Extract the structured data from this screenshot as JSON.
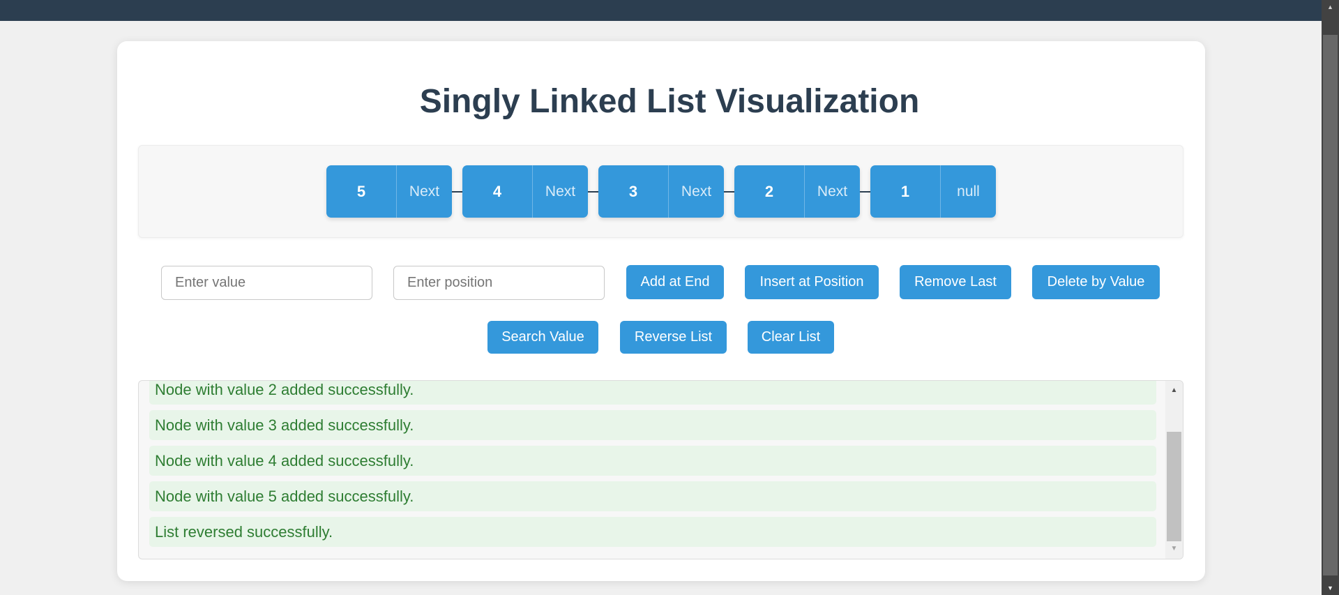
{
  "page": {
    "title": "Singly Linked List Visualization"
  },
  "linked_list": {
    "nodes": [
      {
        "value": "5",
        "pointer": "Next"
      },
      {
        "value": "4",
        "pointer": "Next"
      },
      {
        "value": "3",
        "pointer": "Next"
      },
      {
        "value": "2",
        "pointer": "Next"
      },
      {
        "value": "1",
        "pointer": "null"
      }
    ]
  },
  "controls": {
    "value_input": {
      "value": "",
      "placeholder": "Enter value"
    },
    "position_input": {
      "value": "",
      "placeholder": "Enter position"
    },
    "buttons": {
      "add_at_end": "Add at End",
      "insert_at_position": "Insert at Position",
      "remove_last": "Remove Last",
      "delete_by_value": "Delete by Value",
      "search_value": "Search Value",
      "reverse_list": "Reverse List",
      "clear_list": "Clear List"
    }
  },
  "log": {
    "entries": [
      "Node with value 2 added successfully.",
      "Node with value 3 added successfully.",
      "Node with value 4 added successfully.",
      "Node with value 5 added successfully.",
      "List reversed successfully."
    ]
  },
  "icons": {
    "scroll_up": "▲",
    "scroll_down": "▼"
  },
  "colors": {
    "header": "#2c3e50",
    "accent": "#3498db",
    "success_text": "#2e7d32",
    "success_bg": "#e8f5e9"
  }
}
